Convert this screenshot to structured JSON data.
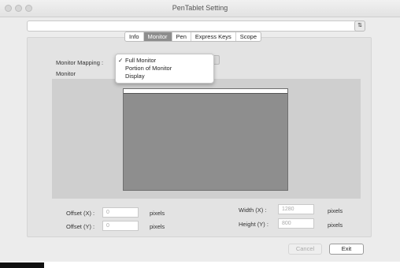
{
  "window": {
    "title": "PenTablet Setting"
  },
  "top_dropdown": {
    "value": "",
    "arrow_icon": "up-down-chevron-icon"
  },
  "tabs": [
    {
      "label": "Info",
      "active": false
    },
    {
      "label": "Monitor",
      "active": true
    },
    {
      "label": "Pen",
      "active": false
    },
    {
      "label": "Express Keys",
      "active": false
    },
    {
      "label": "Scope",
      "active": false
    }
  ],
  "monitor_mapping": {
    "label": "Monitor Mapping :",
    "options": [
      "Full Monitor",
      "Portion of Monitor",
      "Display"
    ],
    "selected": "Full Monitor"
  },
  "monitor_label": "Monitor",
  "offset": {
    "x_label": "Offset (X) :",
    "x_value": "0",
    "y_label": "Offset (Y) :",
    "y_value": "0",
    "unit": "pixels"
  },
  "size": {
    "width_label": "Width (X) :",
    "width_value": "1280",
    "height_label": "Height (Y) :",
    "height_value": "800",
    "unit": "pixels"
  },
  "buttons": {
    "cancel": "Cancel",
    "exit": "Exit"
  }
}
